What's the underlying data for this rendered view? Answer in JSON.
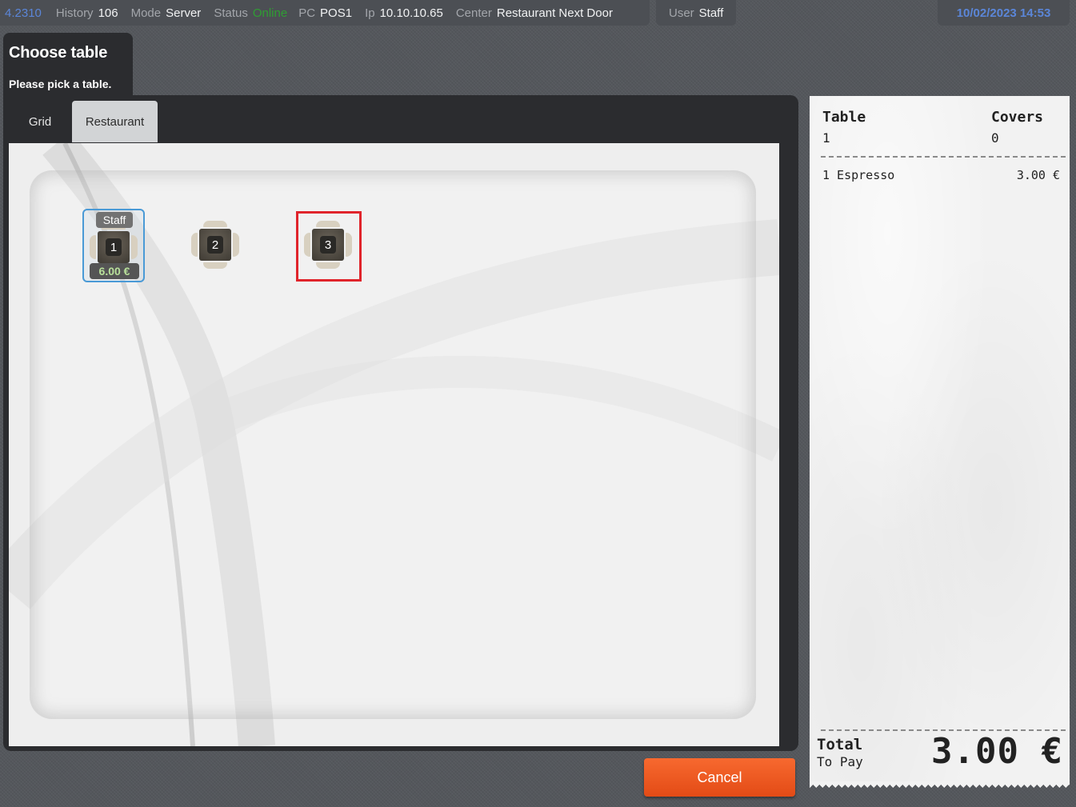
{
  "status_bar": {
    "version": "4.2310",
    "history_label": "History",
    "history_value": "106",
    "mode_label": "Mode",
    "mode_value": "Server",
    "status_label": "Status",
    "status_value": "Online",
    "pc_label": "PC",
    "pc_value": "POS1",
    "ip_label": "Ip",
    "ip_value": "10.10.10.65",
    "center_label": "Center",
    "center_value": "Restaurant Next Door",
    "user_label": "User",
    "user_value": "Staff",
    "datetime": "10/02/2023 14:53"
  },
  "dialog": {
    "title": "Choose table",
    "subtitle": "Please pick a table.",
    "tabs": [
      {
        "label": "Grid",
        "active": false
      },
      {
        "label": "Restaurant",
        "active": true
      }
    ],
    "tables": [
      {
        "number": "1",
        "staff": "Staff",
        "amount": "6.00 €",
        "occupied": true
      },
      {
        "number": "2",
        "occupied": false
      },
      {
        "number": "3",
        "occupied": false,
        "highlighted": true
      }
    ],
    "cancel_label": "Cancel"
  },
  "receipt": {
    "table_label": "Table",
    "table_value": "1",
    "covers_label": "Covers",
    "covers_value": "0",
    "items": [
      {
        "qty_name": "1 Espresso",
        "price": "3.00 €"
      }
    ],
    "total_label": "Total",
    "to_pay_label": "To Pay",
    "total_value": "3.00 €"
  },
  "colors": {
    "accent_blue": "#5b86d8",
    "status_online": "#2f9e33",
    "cancel_orange": "#ef5a22",
    "highlight_red": "#e0242b",
    "selection_blue": "#4a9ad6"
  }
}
